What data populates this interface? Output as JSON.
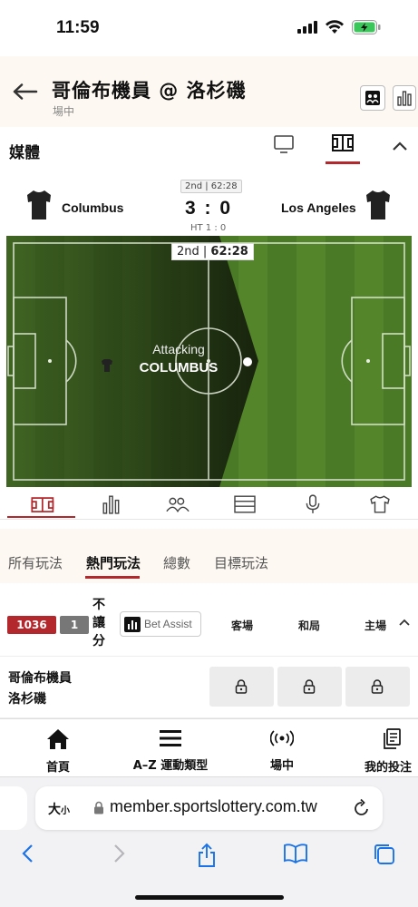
{
  "status_bar": {
    "time": "11:59"
  },
  "header": {
    "title": "哥倫布機員 @ 洛杉磯",
    "subtitle": "場中"
  },
  "media": {
    "label": "媒體"
  },
  "scoreboard": {
    "period": "2nd | 62:28",
    "home_team": "Columbus",
    "away_team": "Los Angeles",
    "score": "3 : 0",
    "halftime": "HT 1 : 0"
  },
  "pitch": {
    "clock_period": "2nd",
    "clock_time": "62:28",
    "attack_label": "Attacking",
    "attack_team": "COLUMBUS"
  },
  "bet_tabs": {
    "items": [
      {
        "label": "所有玩法"
      },
      {
        "label": "熱門玩法"
      },
      {
        "label": "總數"
      },
      {
        "label": "目標玩法"
      }
    ],
    "active": "熱門玩法"
  },
  "market": {
    "count_badge": "1036",
    "secondary_badge": "1",
    "handicap_label": "不讓分",
    "bet_assist": "Bet Assist",
    "columns": [
      "客場",
      "和局",
      "主場"
    ]
  },
  "match_row": {
    "team1": "哥倫布機員",
    "team2": "洛杉磯"
  },
  "bottom_nav": {
    "items": [
      {
        "label": "首頁",
        "icon": "home-icon"
      },
      {
        "label": "A–Z 運動類型",
        "icon": "menu-icon"
      },
      {
        "label": "場中",
        "icon": "live-icon"
      },
      {
        "label": "我的投注",
        "icon": "betslip-icon"
      }
    ]
  },
  "browser": {
    "text_size": "大",
    "text_size_small": "小",
    "url": "member.sportslottery.com.tw"
  },
  "colors": {
    "accent": "#b3282c",
    "header_bg": "#fdf8f1",
    "pitch_green": "#4a7a25",
    "pitch_dark": "#1e2a14"
  }
}
